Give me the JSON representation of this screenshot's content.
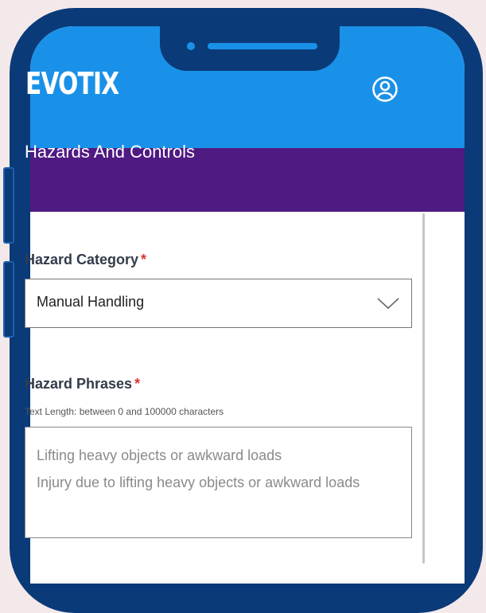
{
  "header": {
    "logo": "EVOTIX",
    "profile_icon": "user-circle-icon",
    "color": "#1a91e8"
  },
  "page": {
    "title": "Hazards And Controls",
    "color": "#4f1a82"
  },
  "form": {
    "hazard_category": {
      "label": "Hazard Category",
      "required_mark": "*",
      "value": "Manual Handling",
      "icon": "chevron-down-icon"
    },
    "hazard_phrases": {
      "label": "Hazard Phrases",
      "required_mark": "*",
      "hint": "Text Length: between 0 and 100000 characters",
      "value": "Lifting heavy objects or awkward loads\nInjury due to lifting heavy objects or awkward loads"
    }
  }
}
